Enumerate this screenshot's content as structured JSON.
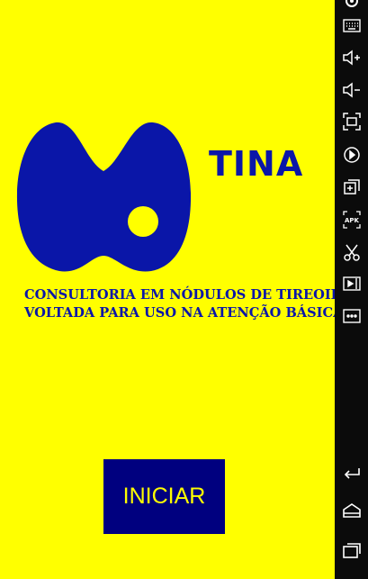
{
  "app": {
    "name": "TINA",
    "subtitle_line1": "CONSULTORIA EM NÓDULOS DE TIREOIDE",
    "subtitle_line2": "VOLTADA PARA USO NA ATENÇÃO BÁSICA",
    "start_label": "INICIAR",
    "colors": {
      "background": "#ffff00",
      "primary": "#0a16a8",
      "button": "#00007f",
      "button_text": "#ffff00"
    }
  },
  "toolbar": {
    "icons": [
      "gear-icon",
      "keyboard-icon",
      "volume-up-icon",
      "volume-down-icon",
      "screenshot-icon",
      "rotate-icon",
      "add-window-icon",
      "apk-install-icon",
      "cut-icon",
      "media-icon",
      "more-icon",
      "back-icon",
      "home-icon",
      "recent-apps-icon"
    ],
    "apk_text": "APK"
  }
}
